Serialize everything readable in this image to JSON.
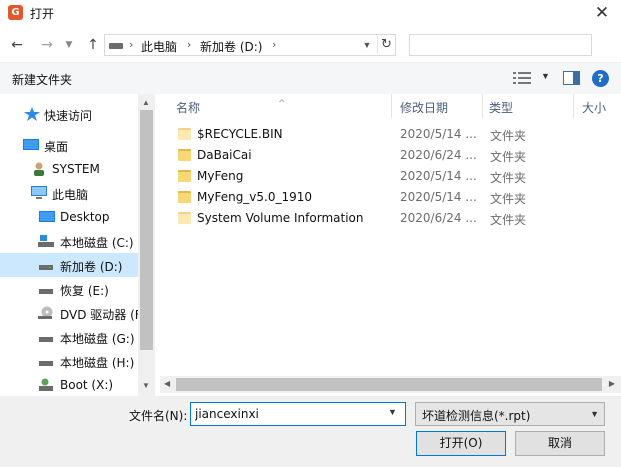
{
  "window": {
    "title": "打开",
    "app_icon_letter": "G"
  },
  "address": {
    "segments": [
      "此电脑",
      "新加卷 (D:)"
    ]
  },
  "toolbar": {
    "new_folder": "新建文件夹",
    "help": "?"
  },
  "nav_pane": {
    "items": [
      {
        "label": "快速访问",
        "icon": "star-icon"
      },
      {
        "label": "桌面",
        "icon": "desktop-icon"
      },
      {
        "label": "SYSTEM",
        "icon": "user-icon"
      },
      {
        "label": "此电脑",
        "icon": "computer-icon"
      },
      {
        "label": "Desktop",
        "icon": "desktop-icon"
      },
      {
        "label": "本地磁盘 (C:)",
        "icon": "drive-icon"
      },
      {
        "label": "新加卷 (D:)",
        "icon": "drive-icon",
        "selected": true
      },
      {
        "label": "恢复 (E:)",
        "icon": "drive-icon"
      },
      {
        "label": "DVD 驱动器 (F",
        "icon": "dvd-icon"
      },
      {
        "label": "本地磁盘 (G:)",
        "icon": "drive-icon"
      },
      {
        "label": "本地磁盘 (H:)",
        "icon": "drive-icon"
      },
      {
        "label": "Boot (X:)",
        "icon": "drive-icon"
      }
    ]
  },
  "file_list": {
    "columns": {
      "name": "名称",
      "date": "修改日期",
      "type": "类型",
      "size": "大小"
    },
    "rows": [
      {
        "name": "$RECYCLE.BIN",
        "date": "2020/5/14 ...",
        "type": "文件夹",
        "hidden": true
      },
      {
        "name": "DaBaiCai",
        "date": "2020/6/24 ...",
        "type": "文件夹"
      },
      {
        "name": "MyFeng",
        "date": "2020/5/14 ...",
        "type": "文件夹"
      },
      {
        "name": "MyFeng_v5.0_1910",
        "date": "2020/5/14 ...",
        "type": "文件夹"
      },
      {
        "name": "System Volume Information",
        "date": "2020/6/24 ...",
        "type": "文件夹",
        "hidden": true
      }
    ]
  },
  "bottom": {
    "filename_label": "文件名(N):",
    "filename_value": "jiancexinxi",
    "filetype_value": "坏道检测信息(*.rpt)",
    "open_button": "打开(O)",
    "cancel_button": "取消"
  },
  "colors": {
    "accent": "#0078d7",
    "selection": "#cce8ff",
    "folder": "#f8d775"
  }
}
